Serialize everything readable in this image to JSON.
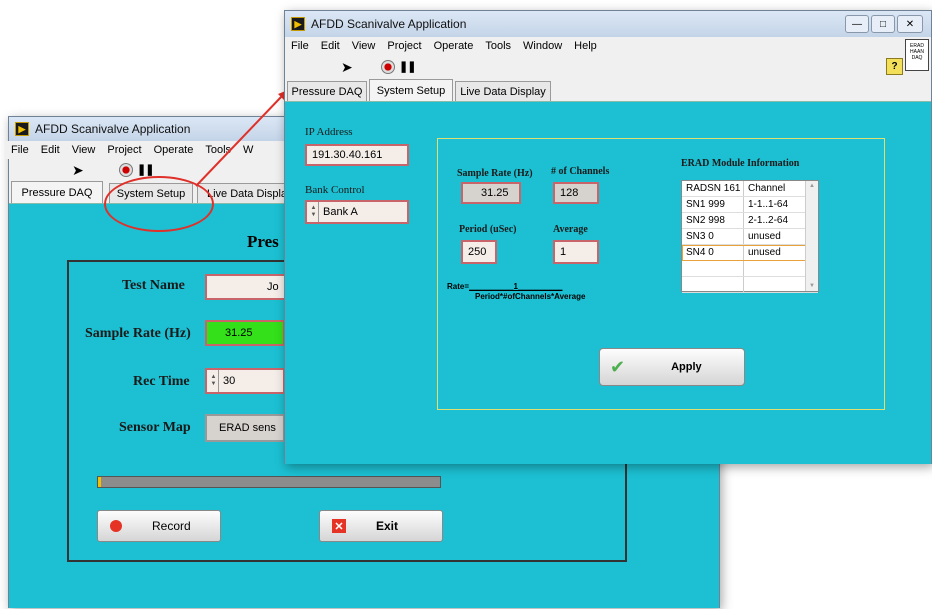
{
  "back_window": {
    "title": "AFDD Scanivalve Application",
    "menu": [
      "File",
      "Edit",
      "View",
      "Project",
      "Operate",
      "Tools",
      "W"
    ],
    "tabs": [
      "Pressure DAQ",
      "System Setup",
      "Live Data Displa"
    ],
    "heading": "Pres",
    "test_name_label": "Test Name",
    "test_name_value": "Jo",
    "sample_rate_label": "Sample Rate (Hz)",
    "sample_rate_value": "31.25",
    "rec_time_label": "Rec Time",
    "rec_time_value": "30",
    "sensor_map_label": "Sensor Map",
    "sensor_map_value": "ERAD sens",
    "record_label": "Record",
    "exit_label": "Exit"
  },
  "front_window": {
    "title": "AFDD Scanivalve Application",
    "menu": [
      "File",
      "Edit",
      "View",
      "Project",
      "Operate",
      "Tools",
      "Window",
      "Help"
    ],
    "tabs": [
      "Pressure DAQ",
      "System Setup",
      "Live Data Display"
    ],
    "corner_label": "ERAD HAAN DAQ",
    "ip_label": "IP Address",
    "ip_value": "191.30.40.161",
    "bank_label": "Bank Control",
    "bank_value": "Bank A",
    "sample_rate_label": "Sample Rate (Hz)",
    "sample_rate_value": "31.25",
    "channels_label": "# of Channels",
    "channels_value": "128",
    "period_label": "Period (uSec)",
    "period_value": "250",
    "average_label": "Average",
    "average_value": "1",
    "rate_prefix": "Rate=",
    "rate_numerator": "1",
    "rate_denominator": "Period*#ofChannels*Average",
    "erad_title": "ERAD Module Information",
    "erad_rows": [
      [
        "RADSN 161",
        "Channel"
      ],
      [
        "SN1 999",
        "1-1..1-64"
      ],
      [
        "SN2 998",
        "2-1..2-64"
      ],
      [
        "SN3 0",
        "unused"
      ],
      [
        "SN4 0",
        "unused"
      ],
      [
        "",
        ""
      ],
      [
        "",
        ""
      ]
    ],
    "apply_label": "Apply"
  },
  "colors": {
    "panel": "#1cc0d2",
    "field_border": "#c9656a",
    "accent_green": "#33e01a",
    "annotation_red": "#e0302a"
  },
  "annotation": "red circle around System Setup tab with arrow pointing to front window"
}
